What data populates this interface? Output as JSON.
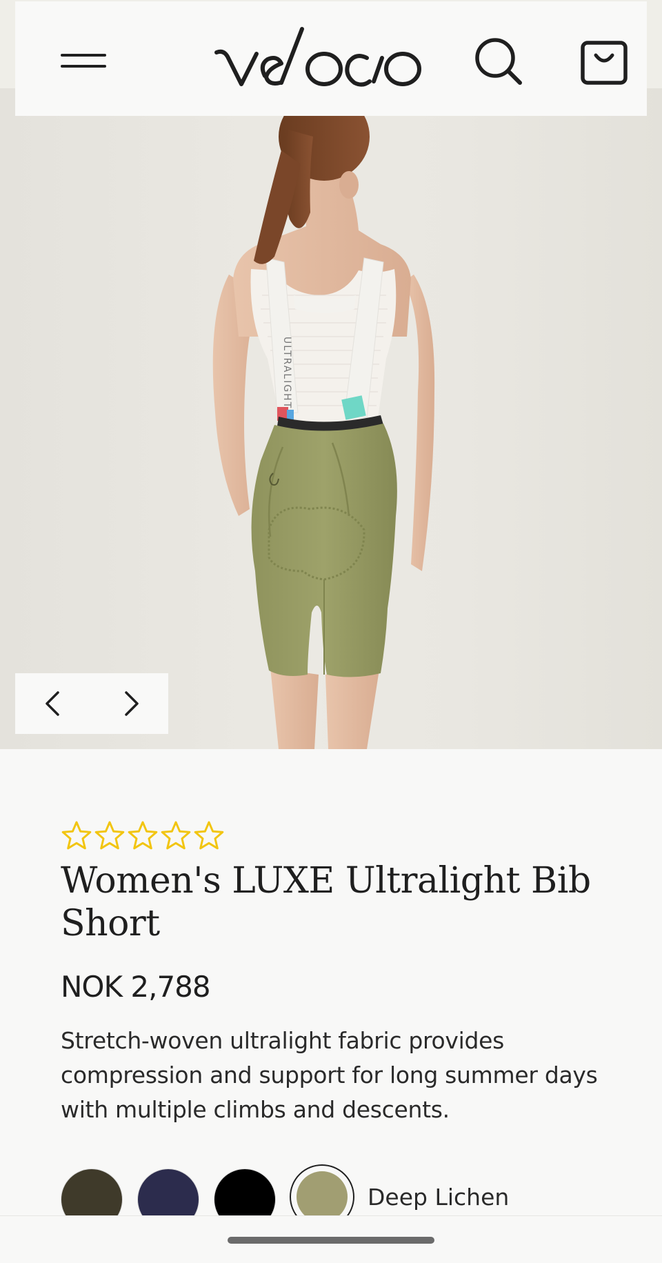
{
  "header": {
    "brand": "velocio",
    "icons": [
      "menu-icon",
      "search-icon",
      "cart-icon"
    ]
  },
  "hero": {
    "strap_text": "ULTRALIGHT",
    "carousel": {
      "prev_icon": "chevron-left-icon",
      "next_icon": "chevron-right-icon"
    }
  },
  "product": {
    "rating": {
      "stars_total": 5,
      "stars_filled": 0,
      "star_color": "#f2c511"
    },
    "title": "Women's LUXE Ultralight Bib Short",
    "price": "NOK 2,788",
    "description": "Stretch-woven ultralight fabric provides compression and support for long summer days with multiple climbs and descents.",
    "swatches": [
      {
        "color": "#3f3a2a",
        "selected": false
      },
      {
        "color": "#2c2c4d",
        "selected": false
      },
      {
        "color": "#000000",
        "selected": false
      },
      {
        "color": "#a19e72",
        "selected": true
      }
    ],
    "selected_color_name": "Deep Lichen"
  }
}
